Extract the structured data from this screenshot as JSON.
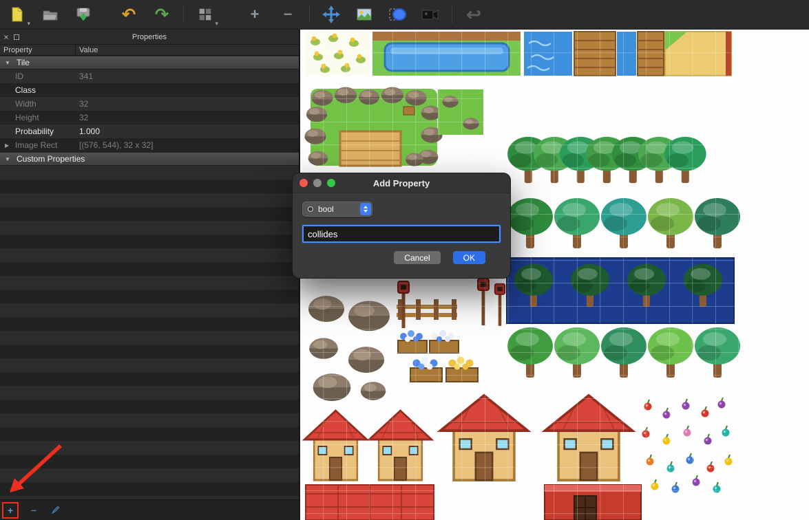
{
  "toolbar": {
    "icons": [
      "new-file-icon",
      "open-file-icon",
      "save-icon",
      "undo-icon",
      "redo-icon",
      "terrain-brush-icon",
      "zoom-in-icon",
      "zoom-out-icon",
      "move-tool-icon",
      "tileset-image-icon",
      "ellipse-select-icon",
      "camera-icon",
      "return-icon"
    ]
  },
  "properties_panel": {
    "title": "Properties",
    "columns": {
      "property": "Property",
      "value": "Value"
    },
    "tile_section_label": "Tile",
    "custom_section_label": "Custom Properties",
    "rows": [
      {
        "property": "ID",
        "value": "341"
      },
      {
        "property": "Class",
        "value": ""
      },
      {
        "property": "Width",
        "value": "32"
      },
      {
        "property": "Height",
        "value": "32"
      },
      {
        "property": "Probability",
        "value": "1.000"
      },
      {
        "property": "Image Rect",
        "value": "[(576, 544), 32 x 32]"
      }
    ],
    "footer": {
      "add_label": "+",
      "remove_label": "−"
    }
  },
  "dialog": {
    "title": "Add Property",
    "type_value": "bool",
    "name_value": "collides",
    "cancel_label": "Cancel",
    "ok_label": "OK"
  },
  "colors": {
    "accent_blue": "#2e6ee8",
    "focus_ring": "#4f8ef7",
    "annotation_red": "#ee2f1f"
  }
}
